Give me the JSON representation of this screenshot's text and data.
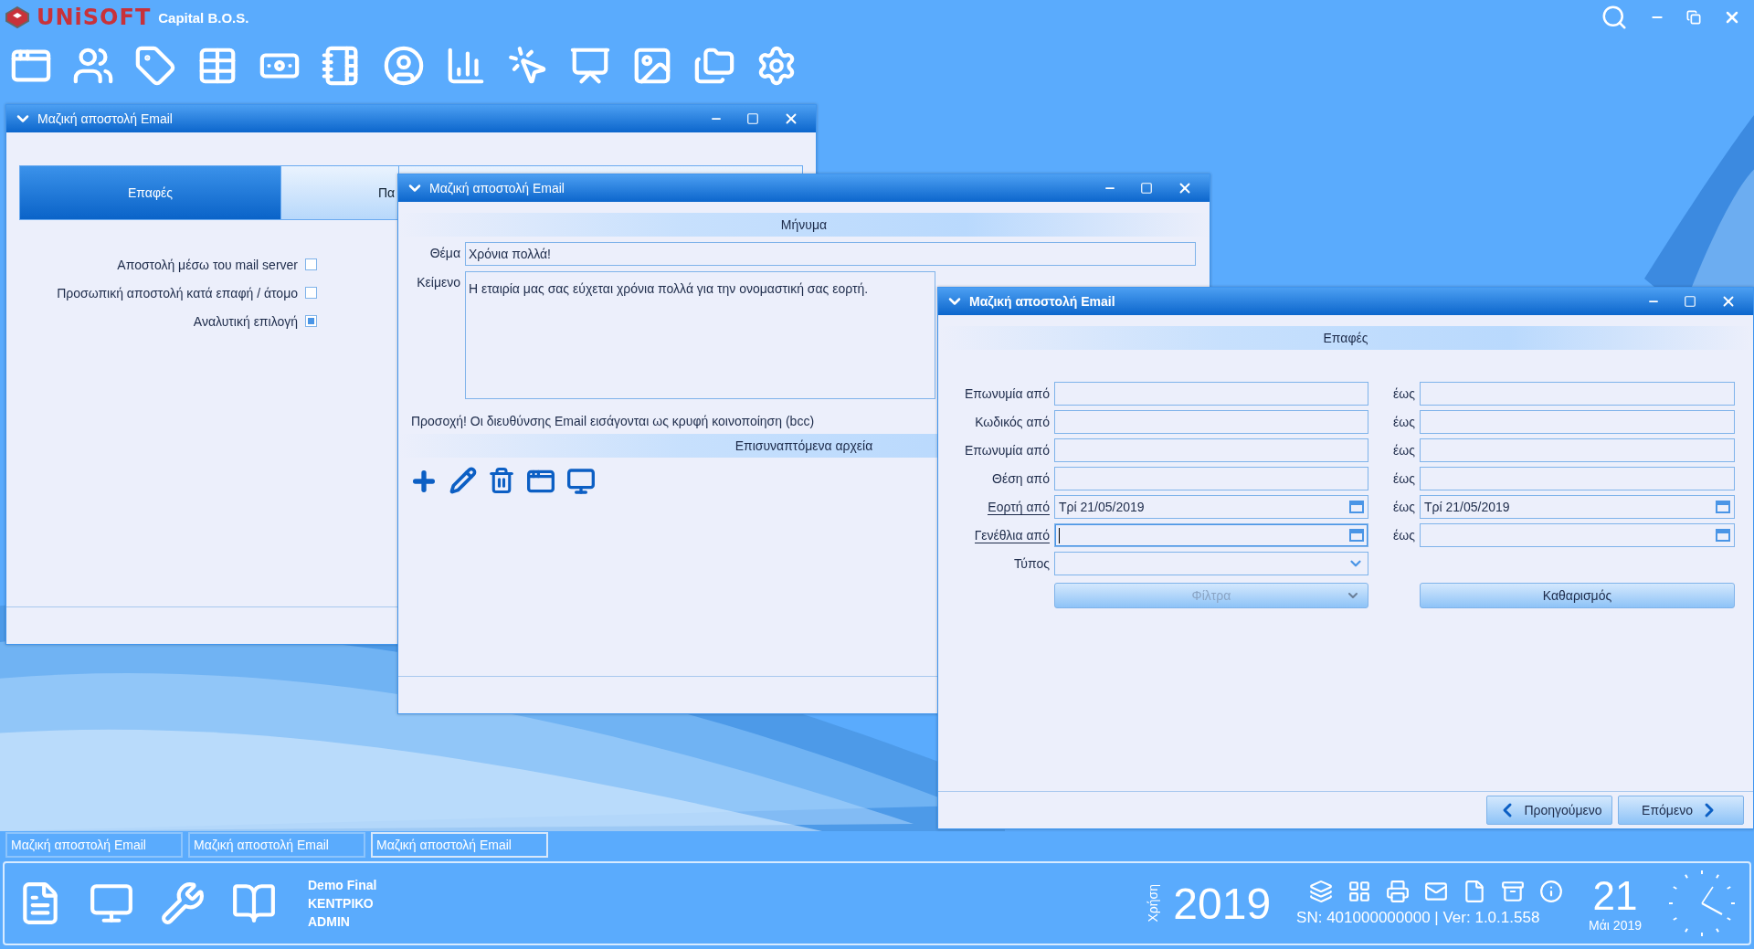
{
  "app": {
    "brand": "UNiSOFT",
    "product": "Capital B.O.S."
  },
  "windows": [
    {
      "kind": "options",
      "title": "Μαζική αποστολή Email",
      "active": false,
      "tabs": [
        {
          "label": "Επαφές",
          "selected": true
        },
        {
          "label": "Πα",
          "selected": false
        }
      ],
      "options": [
        {
          "label": "Αποστολή μέσω του mail server",
          "checked": false
        },
        {
          "label": "Προσωπική αποστολή κατά επαφή / άτομο",
          "checked": false
        },
        {
          "label": "Αναλυτική επιλογή",
          "checked": true
        }
      ]
    },
    {
      "kind": "message",
      "title": "Μαζική αποστολή Email",
      "active": false,
      "message_header": "Μήνυμα",
      "subject_label": "Θέμα",
      "subject": "Χρόνια πολλά!",
      "body_label": "Κείμενο",
      "body": "Η εταιρία μας σας εύχεται χρόνια πολλά για την ονομαστική σας εορτή.",
      "notice": "Προσοχή! Οι διευθύνσης Email εισάγονται ως κρυφή κοινοποίηση  (bcc)",
      "attachments_header": "Επισυναπτόμενα αρχεία"
    },
    {
      "kind": "filter",
      "title": "Μαζική αποστολή Email",
      "active": true,
      "header": "Επαφές",
      "rows": [
        {
          "label": "Επωνυμία από",
          "link": false,
          "to_label": "έως",
          "from": {
            "kind": "text",
            "focused": false
          },
          "to": {
            "kind": "text",
            "focused": false
          }
        },
        {
          "label": "Κωδικός από",
          "link": false,
          "to_label": "έως",
          "from": {
            "kind": "text",
            "focused": false
          },
          "to": {
            "kind": "text",
            "focused": false
          }
        },
        {
          "label": "Επωνυμία από",
          "link": false,
          "to_label": "έως",
          "from": {
            "kind": "text",
            "focused": false
          },
          "to": {
            "kind": "text",
            "focused": false
          }
        },
        {
          "label": "Θέση από",
          "link": false,
          "to_label": "έως",
          "from": {
            "kind": "text",
            "focused": false
          },
          "to": {
            "kind": "text",
            "focused": false
          }
        },
        {
          "label": "Εορτή από",
          "link": true,
          "to_label": "έως",
          "from": {
            "kind": "date",
            "value": "Τρί 21/05/2019",
            "focused": false
          },
          "to": {
            "kind": "date",
            "value": "Τρί 21/05/2019",
            "focused": false
          }
        },
        {
          "label": "Γενέθλια από",
          "link": true,
          "to_label": "έως",
          "from": {
            "kind": "date",
            "focused": true
          },
          "to": {
            "kind": "date",
            "focused": false
          }
        },
        {
          "label": "Τύπος",
          "link": false,
          "from": {
            "kind": "select",
            "focused": false
          }
        }
      ],
      "filter_button": {
        "label": "Φίλτρα",
        "disabled": true
      },
      "clear_button": {
        "label": "Καθαρισμός",
        "disabled": false
      },
      "nav": [
        {
          "kind": "prev",
          "label": "Προηγούμενο"
        },
        {
          "kind": "next",
          "label": "Επόμενο"
        }
      ]
    }
  ],
  "taskbar": [
    {
      "label": "Μαζική αποστολή Email",
      "selected": false
    },
    {
      "label": "Μαζική αποστολή Email",
      "selected": false
    },
    {
      "label": "Μαζική αποστολή Email",
      "selected": true
    }
  ],
  "status": {
    "company": "Demo Final",
    "branch": "ΚΕΝΤΡΙΚΟ",
    "user": "ADMIN",
    "year_label": "Χρήση",
    "year": "2019",
    "serial": "SN: 401000000000 | Ver: 1.0.1.558",
    "day": "21",
    "month": "Μάι 2019"
  }
}
